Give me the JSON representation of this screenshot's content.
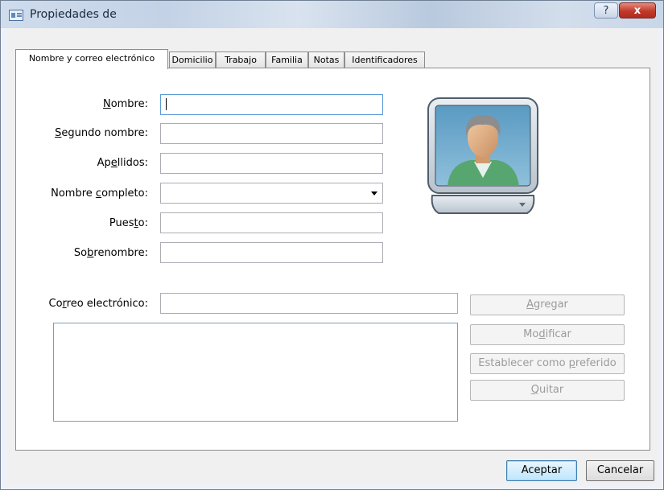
{
  "window": {
    "title": "Propiedades de",
    "help_label": "?",
    "close_label": "x"
  },
  "tabs": [
    {
      "label": "Nombre y correo electrónico",
      "active": true
    },
    {
      "label": "Domicilio",
      "active": false
    },
    {
      "label": "Trabajo",
      "active": false
    },
    {
      "label": "Familia",
      "active": false
    },
    {
      "label": "Notas",
      "active": false
    },
    {
      "label": "Identificadores",
      "active": false
    }
  ],
  "form": {
    "nombre": {
      "pre": "",
      "key": "N",
      "post": "ombre:",
      "value": ""
    },
    "segundo_nombre": {
      "pre": "",
      "key": "S",
      "post": "egundo nombre:",
      "value": ""
    },
    "apellidos": {
      "pre": "Ap",
      "key": "e",
      "post": "llidos:",
      "value": ""
    },
    "nombre_completo": {
      "pre": "Nombre ",
      "key": "c",
      "post": "ompleto:",
      "value": ""
    },
    "puesto": {
      "pre": "Pues",
      "key": "t",
      "post": "o:",
      "value": ""
    },
    "sobrenombre": {
      "pre": "So",
      "key": "b",
      "post": "renombre:",
      "value": ""
    },
    "correo": {
      "pre": "Co",
      "key": "r",
      "post": "reo electrónico:",
      "value": ""
    }
  },
  "email_buttons": {
    "agregar": {
      "pre": "",
      "key": "A",
      "post": "gregar"
    },
    "modificar": {
      "pre": "Mo",
      "key": "d",
      "post": "ificar"
    },
    "preferido": {
      "pre": "Establecer como ",
      "key": "p",
      "post": "referido"
    },
    "quitar": {
      "pre": "",
      "key": "Q",
      "post": "uitar"
    }
  },
  "footer": {
    "ok_label": "Aceptar",
    "cancel_label": "Cancelar"
  },
  "icons": {
    "app": "contact-card-icon",
    "photo": "contact-photo-icon"
  }
}
